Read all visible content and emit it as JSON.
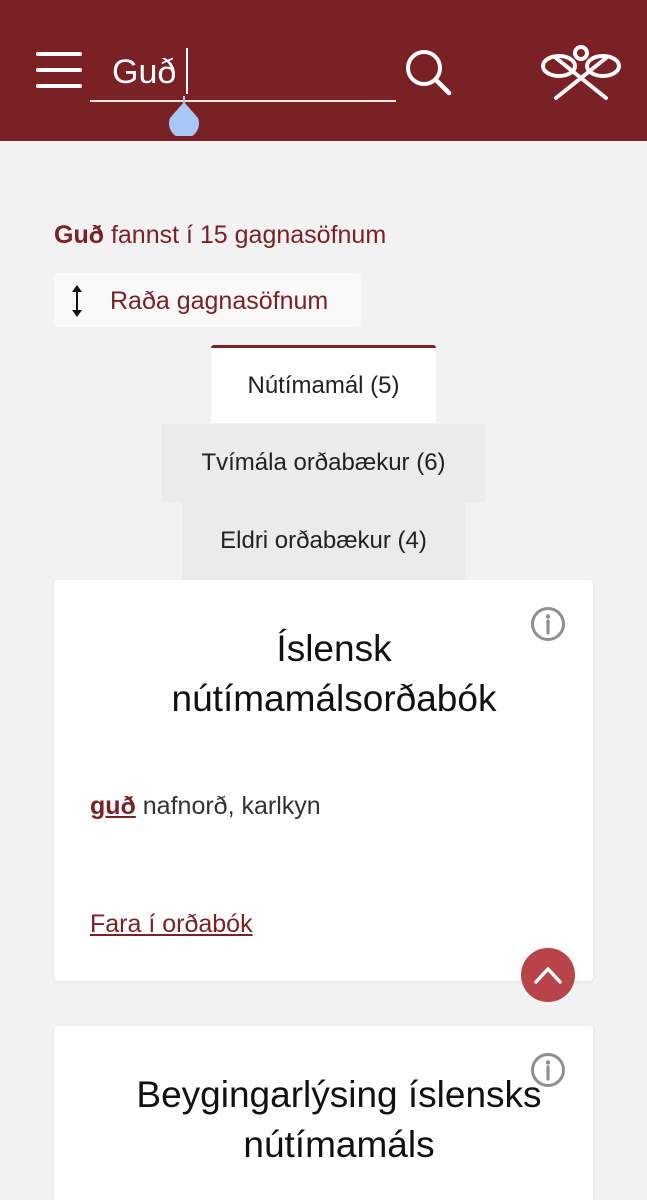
{
  "header": {
    "search": {
      "value": "Guð",
      "placeholder": ""
    },
    "colors": {
      "brand": "#7a2126",
      "accent": "#b8444a",
      "caret_handle": "#a9c7f5"
    }
  },
  "results": {
    "query": "Guð",
    "summary_suffix": "fannst í 15 gagnasöfnum",
    "sort_label": "Raða gagnasöfnum"
  },
  "tabs": [
    {
      "label": "Nútímamál (5)",
      "active": true
    },
    {
      "label": "Tvímála orðabækur (6)",
      "active": false
    },
    {
      "label": "Eldri orðabækur (4)",
      "active": false
    }
  ],
  "cards": [
    {
      "title": "Íslensk nútímamálsorðabók",
      "entry_word": "guð",
      "entry_info": "nafnorð, karlkyn",
      "link": "Fara í orðabók"
    },
    {
      "title": "Beygingarlýsing íslensks nútímamáls"
    }
  ],
  "icons": [
    "menu-icon",
    "search-icon",
    "logo-icon",
    "sort-arrows-icon",
    "info-icon",
    "chevron-up-icon"
  ]
}
